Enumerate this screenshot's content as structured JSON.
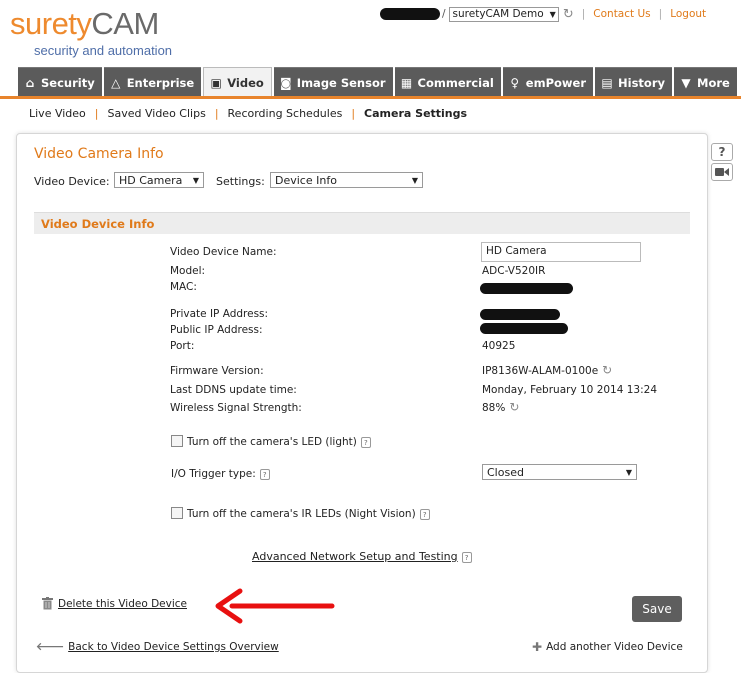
{
  "header": {
    "logo_part1": "surety",
    "logo_part2": "CAM",
    "logo_sub": "security and automation",
    "account_name": "suretyCAM Demo",
    "contact_label": "Contact Us",
    "logout_label": "Logout"
  },
  "tabs": [
    {
      "label": "Security",
      "icon": "house-icon"
    },
    {
      "label": "Enterprise",
      "icon": "network-icon"
    },
    {
      "label": "Video",
      "icon": "video-icon"
    },
    {
      "label": "Image Sensor",
      "icon": "camera-icon"
    },
    {
      "label": "Commercial",
      "icon": "building-icon"
    },
    {
      "label": "emPower",
      "icon": "bulb-icon"
    },
    {
      "label": "History",
      "icon": "calendar-icon"
    },
    {
      "label": "More",
      "icon": "triangle-down-icon"
    }
  ],
  "subnav": [
    "Live Video",
    "Saved Video Clips",
    "Recording Schedules",
    "Camera Settings"
  ],
  "panel": {
    "title": "Video Camera Info",
    "video_device_label": "Video Device:",
    "video_device_value": "HD Camera",
    "settings_label": "Settings:",
    "settings_value": "Device Info",
    "section_title": "Video Device Info",
    "help_glyph": "?"
  },
  "info": {
    "name_label": "Video Device Name:",
    "name_value": "HD Camera",
    "model_label": "Model:",
    "model_value": "ADC-V520IR",
    "mac_label": "MAC:",
    "private_ip_label": "Private IP Address:",
    "public_ip_label": "Public IP Address:",
    "port_label": "Port:",
    "port_value": "40925",
    "firmware_label": "Firmware Version:",
    "firmware_value": "IP8136W-ALAM-0100e",
    "ddns_label": "Last DDNS update time:",
    "ddns_value": "Monday, February 10 2014 13:24",
    "signal_label": "Wireless Signal Strength:",
    "signal_value": "88%"
  },
  "options": {
    "led_label": "Turn off the camera's LED (light)",
    "led_checked": false,
    "io_label": "I/O Trigger type:",
    "io_value": "Closed",
    "ir_label": "Turn off the camera's IR LEDs (Night Vision)",
    "ir_checked": false,
    "advanced_link": "Advanced Network Setup and Testing"
  },
  "actions": {
    "delete_label": "Delete this Video Device",
    "save_label": "Save",
    "back_label": "Back to Video Device Settings Overview",
    "add_label": "Add another Video Device"
  },
  "colors": {
    "accent": "#e8842c",
    "tab_bg": "#5b5b5b",
    "annotation_arrow": "#e81010"
  }
}
